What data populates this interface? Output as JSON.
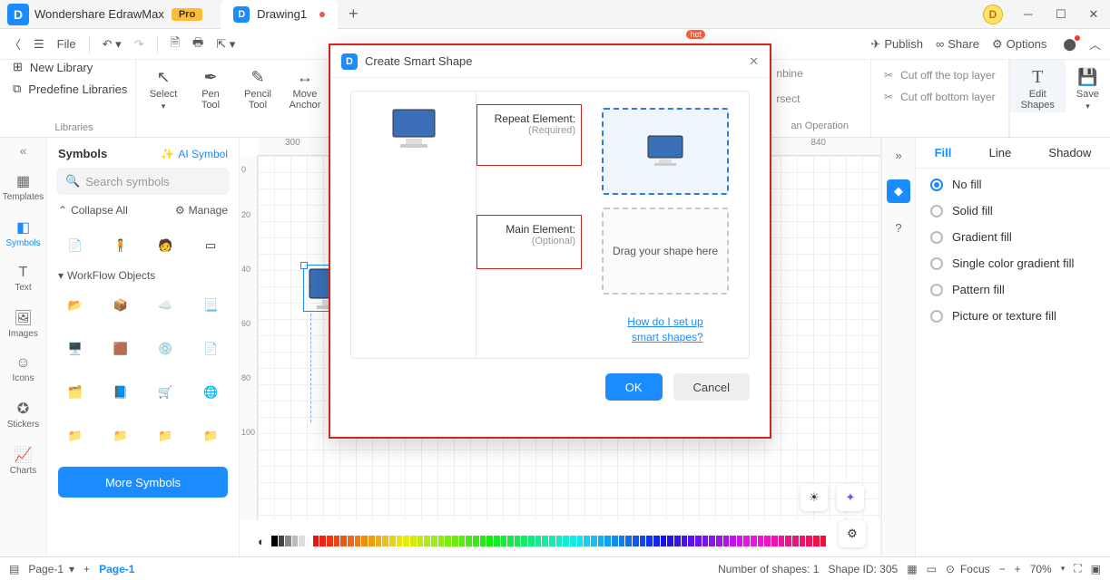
{
  "app": {
    "title": "Wondershare EdrawMax",
    "badge": "Pro",
    "user_initial": "D"
  },
  "doc_tab": {
    "name": "Drawing1",
    "new_tab": "+"
  },
  "toolbar": {
    "file": "File",
    "publish": "Publish",
    "share": "Share",
    "options": "Options"
  },
  "ribbon": {
    "new_library": "New Library",
    "predefine_libraries": "Predefine Libraries",
    "libraries_caption": "Libraries",
    "select": "Select",
    "pen_tool": "Pen\nTool",
    "pencil_tool": "Pencil\nTool",
    "move_anchor": "Move\nAnchor",
    "combine_fragment": "nbine",
    "intersect_fragment": "rsect",
    "boolean_caption": "an Operation",
    "cut_top": "Cut off the top layer",
    "cut_bottom": "Cut off bottom layer",
    "edit_shapes": "Edit\nShapes",
    "save": "Save"
  },
  "rail": {
    "templates": "Templates",
    "symbols": "Symbols",
    "text": "Text",
    "images": "Images",
    "icons": "Icons",
    "stickers": "Stickers",
    "charts": "Charts"
  },
  "symbols_panel": {
    "title": "Symbols",
    "ai_symbol": "AI Symbol",
    "search_placeholder": "Search symbols",
    "collapse_all": "Collapse All",
    "manage": "Manage",
    "category": "WorkFlow Objects",
    "more": "More Symbols"
  },
  "ruler_marks": [
    "20",
    "40",
    "60",
    "80",
    "100"
  ],
  "ruler_top": [
    "300",
    "840"
  ],
  "props": {
    "tabs": {
      "fill": "Fill",
      "line": "Line",
      "shadow": "Shadow"
    },
    "options": {
      "no_fill": "No fill",
      "solid": "Solid fill",
      "gradient": "Gradient fill",
      "single_gradient": "Single color gradient fill",
      "pattern": "Pattern fill",
      "picture": "Picture or texture fill"
    }
  },
  "status": {
    "page": "Page-1",
    "page_tab": "Page-1",
    "shapes_count": "Number of shapes: 1",
    "shape_id": "Shape ID: 305",
    "focus": "Focus",
    "zoom": "70%"
  },
  "dialog": {
    "title": "Create Smart Shape",
    "repeat_label": "Repeat Element:",
    "repeat_sub": "(Required)",
    "main_label": "Main Element:",
    "main_sub": "(Optional)",
    "drag_hint": "Drag your shape here",
    "help_line1": "How do I set up",
    "help_line2": "smart shapes?",
    "ok": "OK",
    "cancel": "Cancel"
  }
}
